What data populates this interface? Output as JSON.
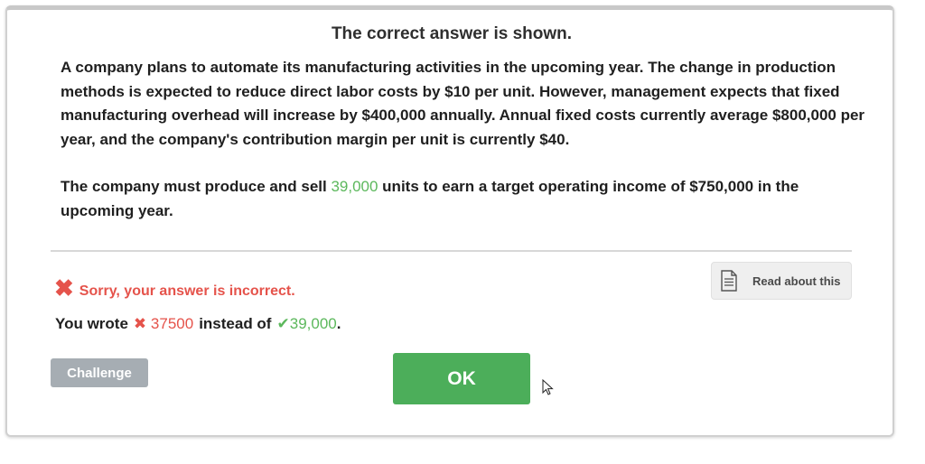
{
  "header": {
    "title": "The correct answer is shown."
  },
  "question": {
    "paragraph1": "A company plans to automate its manufacturing activities in the upcoming year. The change in production methods is expected to reduce direct labor costs by $10 per unit. However, management expects that fixed manufacturing overhead will increase by $400,000 annually. Annual fixed costs currently average $800,000 per year, and the company's contribution margin per unit is currently $40.",
    "paragraph2_before": "The company must produce and sell ",
    "paragraph2_answer": "39,000",
    "paragraph2_after": " units to earn a target operating income of $750,000 in the upcoming year."
  },
  "feedback": {
    "icon": "x-icon",
    "message": "Sorry, your answer is incorrect.",
    "you_wrote_label": "You wrote",
    "wrong_value": "37500",
    "instead_of_label": "instead of",
    "correct_value": "39,000",
    "trailing": "."
  },
  "buttons": {
    "read_about": "Read about this",
    "challenge": "Challenge",
    "ok": "OK"
  },
  "colors": {
    "correct": "#5cb85c",
    "incorrect": "#e5534b",
    "ok_button": "#4cae5a",
    "challenge_button": "#a6adb3"
  }
}
